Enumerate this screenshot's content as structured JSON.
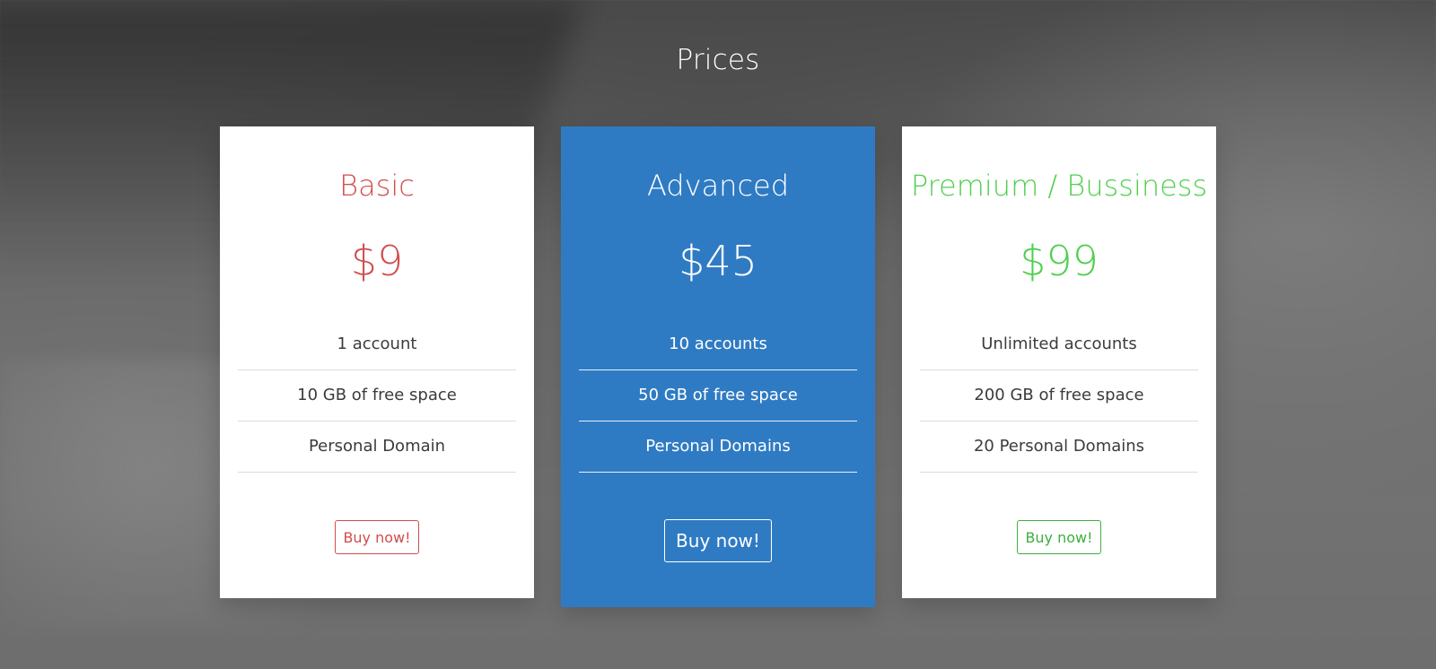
{
  "page": {
    "title": "Prices",
    "background_style": "blurred photo of a laptop, dark gray overlay"
  },
  "plans": [
    {
      "name": "Basic",
      "price": "$9",
      "accent_color": "#d24d4d",
      "features": [
        "1 account",
        "10 GB of free space",
        "Personal Domain"
      ],
      "button_label": "Buy now!"
    },
    {
      "name": "Advanced",
      "price": "$45",
      "accent_color": "#2f7bc3",
      "featured": true,
      "features": [
        "10 accounts",
        "50 GB of free space",
        "Personal Domains"
      ],
      "button_label": "Buy now!"
    },
    {
      "name": "Premium / Bussiness",
      "price": "$99",
      "accent_color": "#4fcf4f",
      "features": [
        "Unlimited accounts",
        "200 GB of free space",
        "20 Personal Domains"
      ],
      "button_label": "Buy now!"
    }
  ]
}
